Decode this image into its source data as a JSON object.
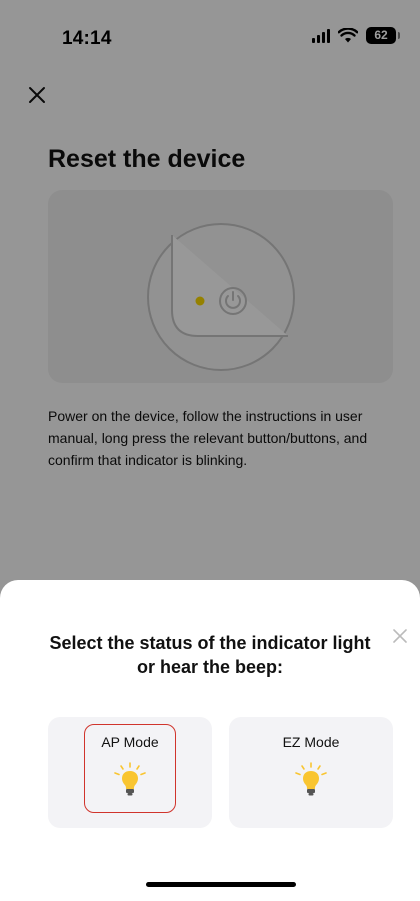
{
  "status_bar": {
    "time": "14:14",
    "battery": "62"
  },
  "page": {
    "title": "Reset the device",
    "instructions": "Power on the device, follow the instructions in user manual, long press the relevant button/buttons, and confirm that indicator is blinking."
  },
  "illustration": {
    "indicator_color": "#f0d000",
    "icons": [
      "power-icon"
    ]
  },
  "sheet": {
    "title": "Select the status of the indicator light or hear the beep:",
    "options": [
      {
        "label": "AP Mode",
        "icon": "lightbulb-icon",
        "selected": true
      },
      {
        "label": "EZ Mode",
        "icon": "lightbulb-icon",
        "selected": false
      }
    ]
  },
  "colors": {
    "highlight": "#d0342c",
    "bulb": "#f9c531",
    "overlay": "rgba(0,0,0,0.38)"
  }
}
